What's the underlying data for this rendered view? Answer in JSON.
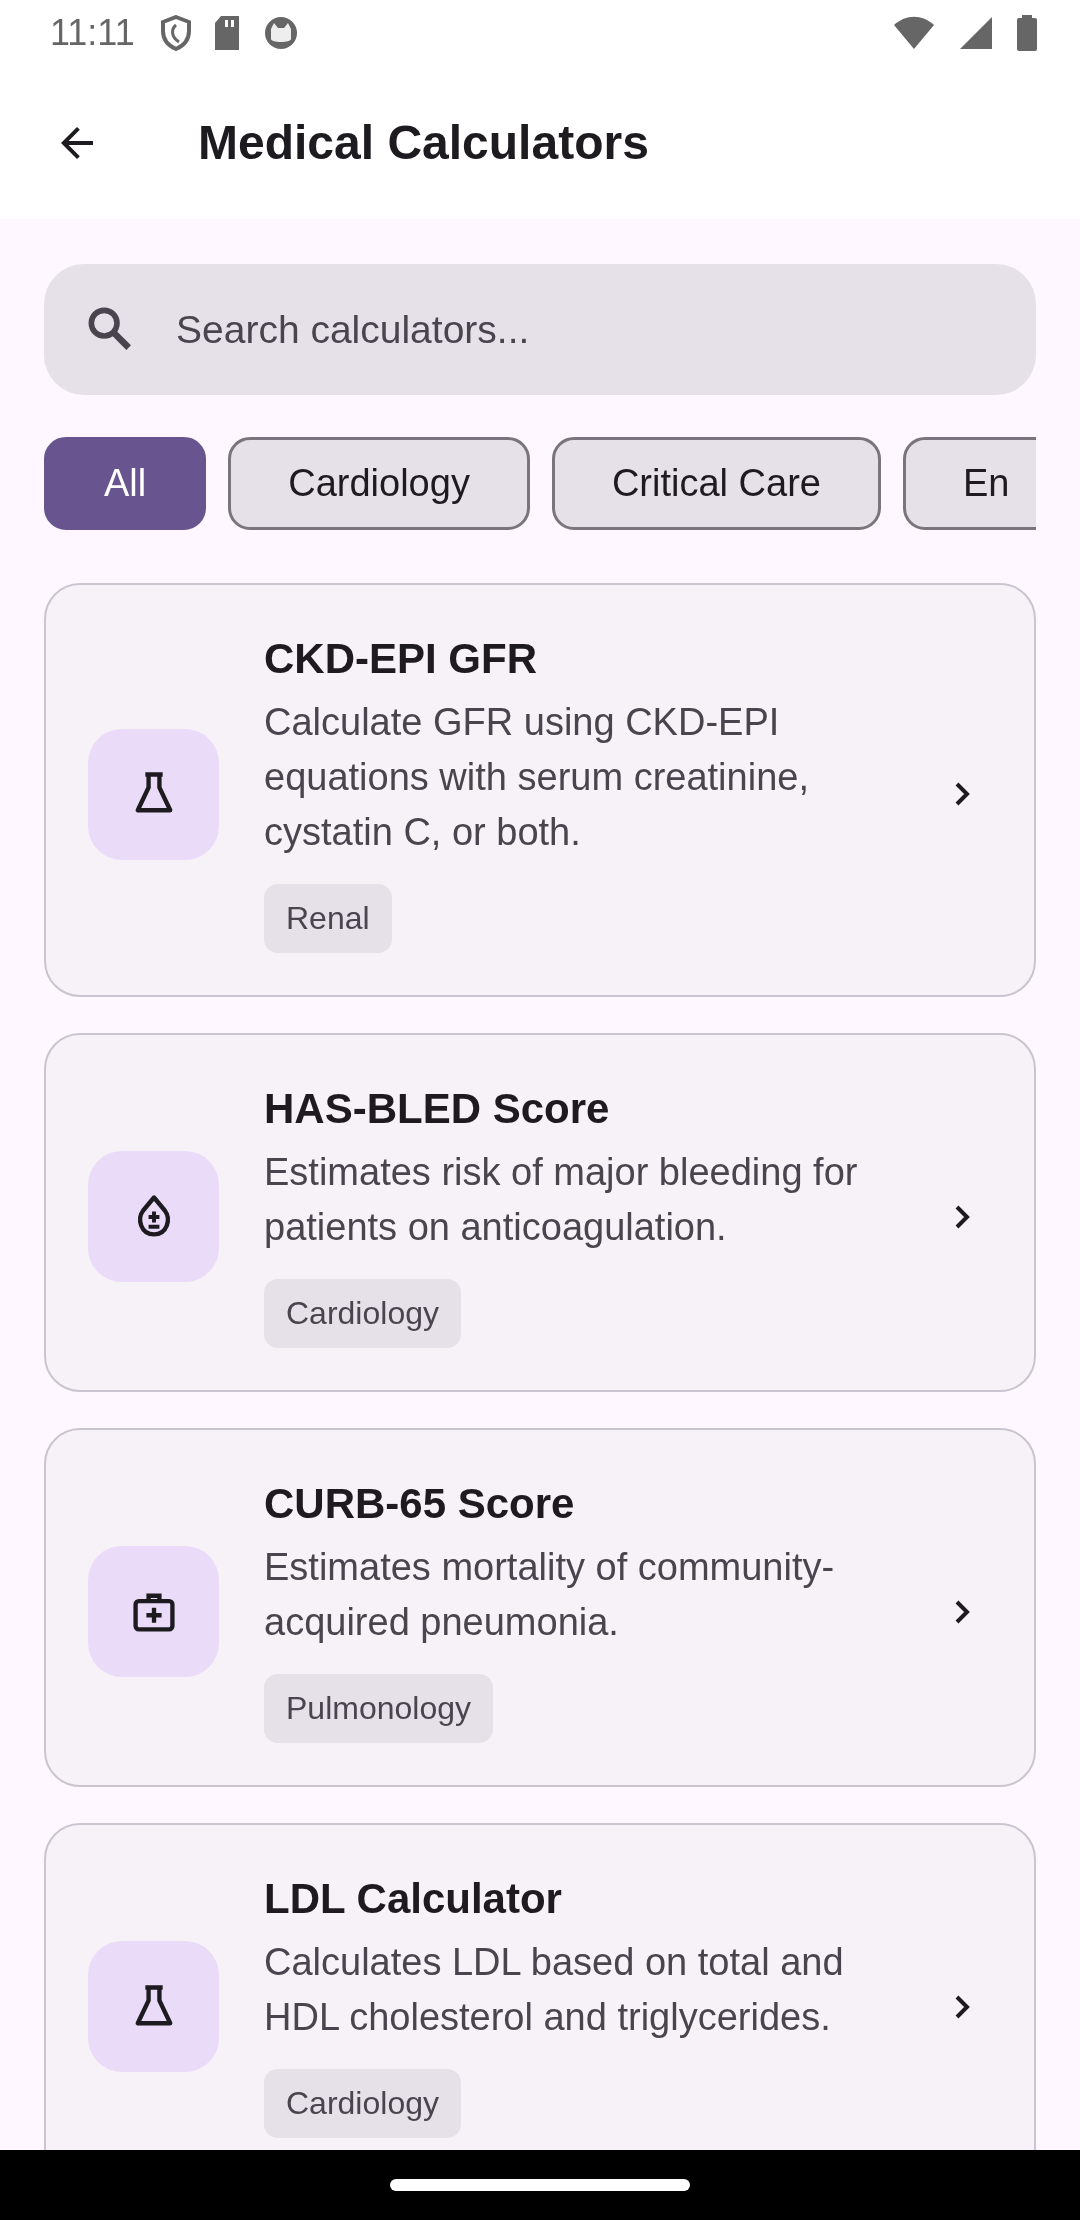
{
  "status_bar": {
    "time": "11:11"
  },
  "app_bar": {
    "title": "Medical Calculators"
  },
  "search": {
    "placeholder": "Search calculators..."
  },
  "filters": [
    {
      "label": "All",
      "selected": true
    },
    {
      "label": "Cardiology",
      "selected": false
    },
    {
      "label": "Critical Care",
      "selected": false
    },
    {
      "label": "En",
      "selected": false
    }
  ],
  "calculators": [
    {
      "kind": "flask",
      "title": "CKD-EPI GFR",
      "description": "Calculate GFR using CKD-EPI equations with serum creatinine, cystatin C, or both.",
      "tag": "Renal"
    },
    {
      "kind": "drop",
      "title": "HAS-BLED Score",
      "description": "Estimates risk of major bleeding for patients on anticoagulation.",
      "tag": "Cardiology"
    },
    {
      "kind": "kit",
      "title": "CURB-65 Score",
      "description": "Estimates mortality of community-acquired pneumonia.",
      "tag": "Pulmonology"
    },
    {
      "kind": "flask",
      "title": "LDL Calculator",
      "description": "Calculates LDL based on total and HDL cholesterol and triglycerides.",
      "tag": "Cardiology"
    }
  ]
}
